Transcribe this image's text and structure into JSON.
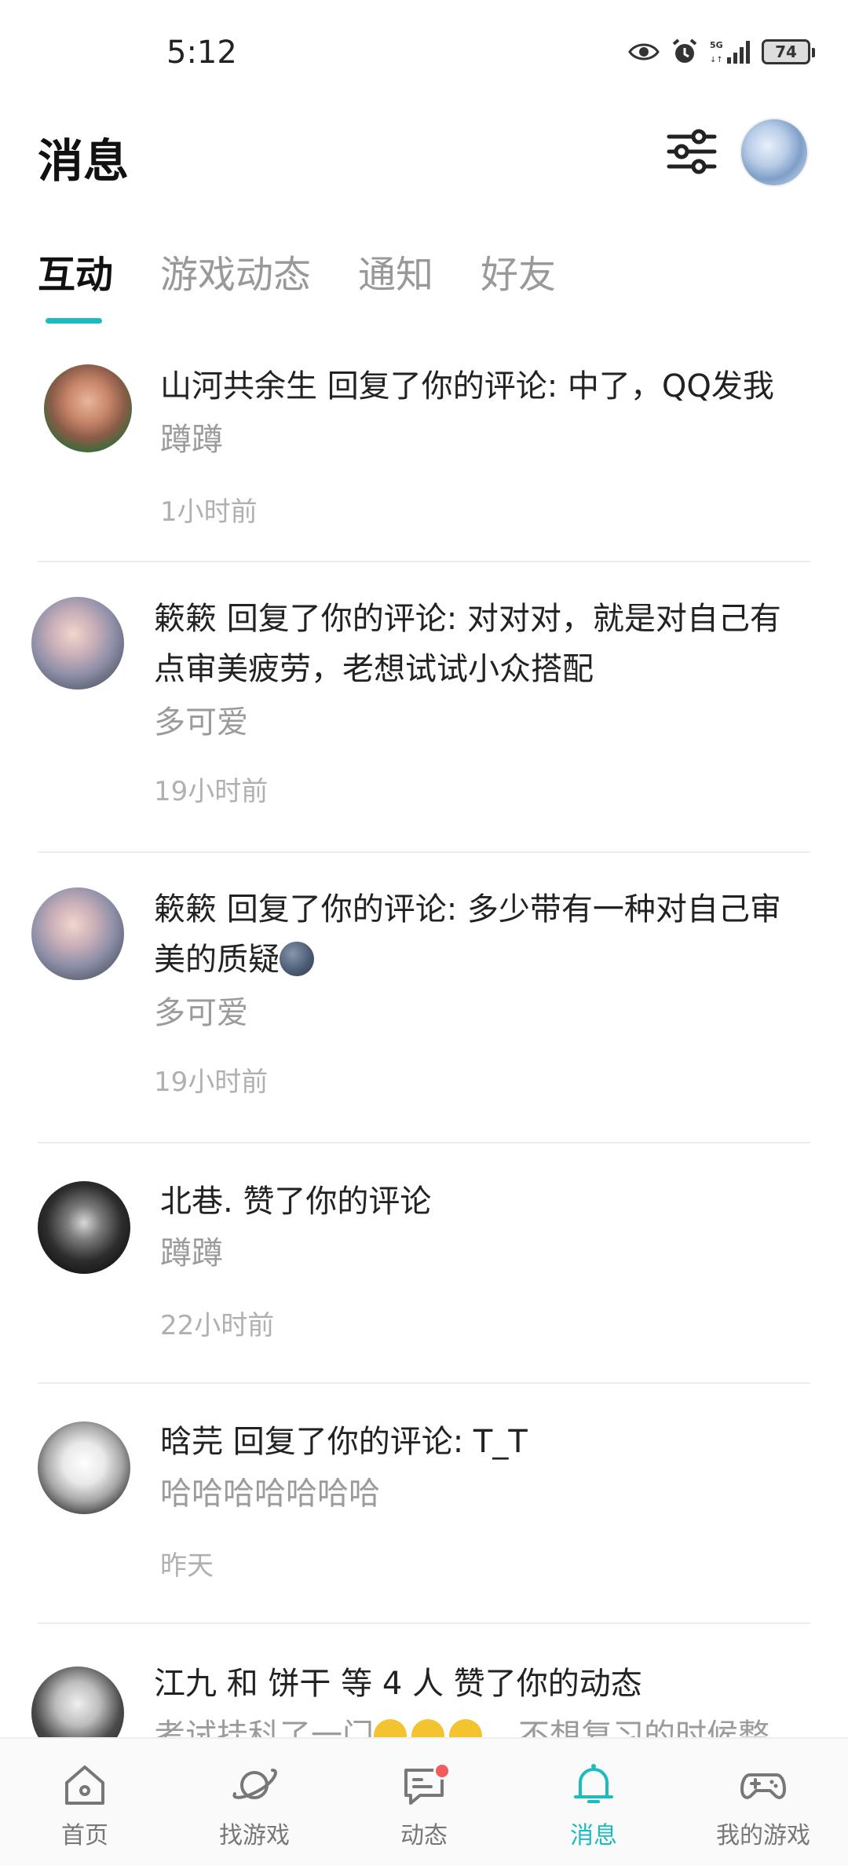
{
  "status_bar": {
    "time": "5:12",
    "network": "5G",
    "battery": "74"
  },
  "header": {
    "title": "消息",
    "filter_icon": "sliders-icon",
    "avatar_icon": "user-avatar"
  },
  "tabs": [
    {
      "label": "互动",
      "active": true
    },
    {
      "label": "游戏动态",
      "active": false
    },
    {
      "label": "通知",
      "active": false
    },
    {
      "label": "好友",
      "active": false
    }
  ],
  "messages": [
    {
      "user": "山河共余生",
      "action": "回复了你的评论:",
      "content": "中了，QQ发我",
      "quote": "蹲蹲",
      "time": "1小时前"
    },
    {
      "user": "簌簌",
      "action": "回复了你的评论:",
      "content": "对对对，就是对自己有点审美疲劳，老想试试小众搭配",
      "quote": "多可爱",
      "time": "19小时前"
    },
    {
      "user": "簌簌",
      "action": "回复了你的评论:",
      "content": "多少带有一种对自己审美的质疑",
      "quote": "多可爱",
      "time": "19小时前"
    },
    {
      "user": "北巷.",
      "action": "赞了你的评论",
      "content": "",
      "quote": "蹲蹲",
      "time": "22小时前"
    },
    {
      "user": "晗芫",
      "action": "回复了你的评论:",
      "content": "T_T",
      "quote": "哈哈哈哈哈哈哈",
      "time": "昨天"
    },
    {
      "user": "江九 和 饼干 等 4 人",
      "action": "赞了你的动态",
      "content": "",
      "quote": "考试挂科了一门",
      "quote_tail": "，不想复习的时候整",
      "time": ""
    }
  ],
  "bottom_nav": [
    {
      "label": "首页",
      "icon": "home-icon",
      "active": false
    },
    {
      "label": "找游戏",
      "icon": "planet-icon",
      "active": false
    },
    {
      "label": "动态",
      "icon": "chat-icon",
      "active": false,
      "badge": true
    },
    {
      "label": "消息",
      "icon": "bell-icon",
      "active": true
    },
    {
      "label": "我的游戏",
      "icon": "gamepad-icon",
      "active": false
    }
  ],
  "colors": {
    "accent": "#1bbcbf",
    "badge": "#f25c5c",
    "muted_text": "#9b9b9b",
    "time_text": "#b0b0b0"
  }
}
